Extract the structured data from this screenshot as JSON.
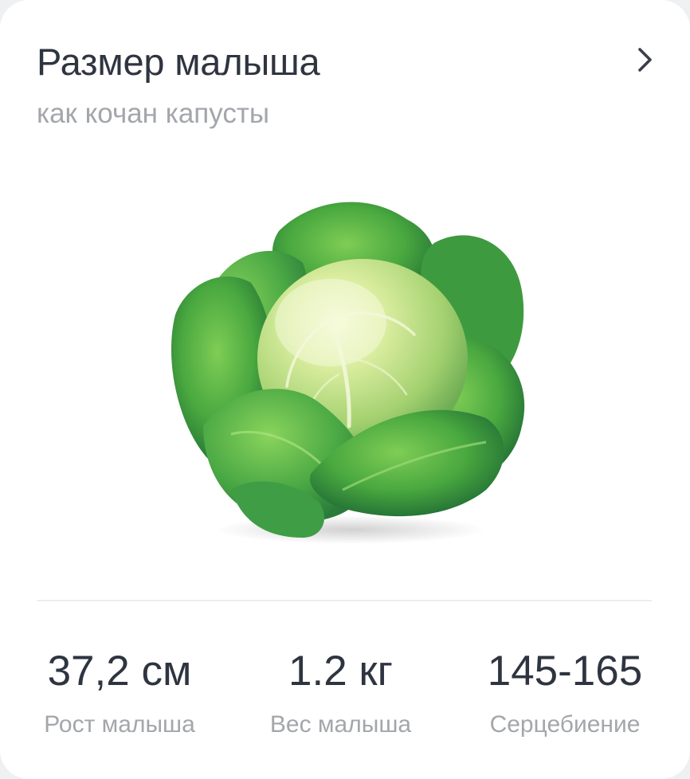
{
  "card": {
    "title": "Размер малыша",
    "subtitle": "как кочан капусты",
    "chevron_icon": "chevron-right-icon",
    "image_subject": "cabbage-illustration"
  },
  "stats": [
    {
      "value": "37,2 см",
      "label": "Рост малыша"
    },
    {
      "value": "1.2 кг",
      "label": "Вес малыша"
    },
    {
      "value": "145-165",
      "label": "Серцебиение"
    }
  ],
  "colors": {
    "title": "#2f3540",
    "muted": "#a3a6ab",
    "divider": "#eceef0",
    "card_background": "#ffffff"
  }
}
